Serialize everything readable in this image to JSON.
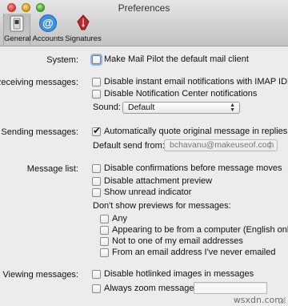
{
  "window": {
    "title": "Preferences"
  },
  "toolbar": {
    "items": [
      {
        "label": "General",
        "icon": "general-switch-icon",
        "selected": true
      },
      {
        "label": "Accounts",
        "icon": "at-sign-icon",
        "selected": false
      },
      {
        "label": "Signatures",
        "icon": "pen-nib-icon",
        "selected": false
      }
    ]
  },
  "system": {
    "label": "System:",
    "default_client": {
      "label": "Make Mail Pilot the default mail client",
      "checked": false
    }
  },
  "receiving": {
    "label": "Receiving messages:",
    "imap_idle": {
      "label": "Disable instant email notifications with IMAP IDLE",
      "checked": false
    },
    "notification_center": {
      "label": "Disable Notification Center notifications",
      "checked": false
    },
    "sound_label": "Sound:",
    "sound_value": "Default"
  },
  "sending": {
    "label": "Sending messages:",
    "quote_original": {
      "label": "Automatically quote original message in replies",
      "checked": true
    },
    "default_send_label": "Default send from:",
    "default_send_value": "bchavanu@makeuseof.com"
  },
  "message_list": {
    "label": "Message list:",
    "disable_confirmations": {
      "label": "Disable confirmations before message moves",
      "checked": false
    },
    "disable_attachment_preview": {
      "label": "Disable attachment preview",
      "checked": false
    },
    "show_unread": {
      "label": "Show unread indicator",
      "checked": false
    },
    "previews_heading": "Don't show previews for messages:",
    "any": {
      "label": "Any",
      "checked": false
    },
    "from_computer": {
      "label": "Appearing to be from a computer (English only)",
      "checked": false
    },
    "not_my_addresses": {
      "label": "Not to one of my email addresses",
      "checked": false
    },
    "never_emailed": {
      "label": "From an email address I've never emailed",
      "checked": false
    }
  },
  "viewing": {
    "label": "Viewing messages:",
    "disable_hotlinked": {
      "label": "Disable hotlinked images in messages",
      "checked": false
    },
    "always_zoom": {
      "label": "Always zoom messages:",
      "checked": false
    },
    "zoom_value": ""
  },
  "watermark": "wsxdn.com"
}
